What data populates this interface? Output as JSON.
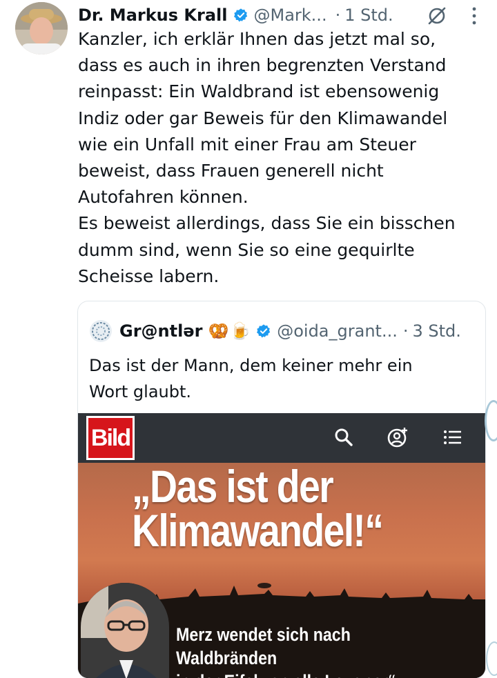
{
  "tweet": {
    "author_name": "Dr. Markus Krall",
    "handle": "@Mark...",
    "separator": "·",
    "time": "1 Std.",
    "text": "Kanzler, ich erklär Ihnen das jetzt mal so,\ndass es auch in ihren begrenzten Verstand\nreinpasst: Ein Waldbrand ist ebensowenig\nIndiz oder gar Beweis für den Klimawandel\nwie ein Unfall mit einer Frau am Steuer\nbeweist, dass Frauen generell nicht\nAutofahren können.\nEs beweist allerdings, dass Sie ein bisschen\ndumm sind, wenn Sie so eine gequirlte\nScheisse labern.",
    "icons": {
      "verified": "verified-badge-icon",
      "grok": "grok-icon",
      "more": "more-options-icon"
    }
  },
  "quote": {
    "author_name": "Gr@ntlər",
    "emoji": [
      "🥨",
      "🍺"
    ],
    "handle": "@oida_grant...",
    "separator": "·",
    "time": "3 Std.",
    "text": "Das ist der Mann, dem keiner mehr ein\nWort glaubt.",
    "media": {
      "logo_text": "Bild",
      "headline": "„Das ist der\nKlimawandel!“",
      "subheadline": "Merz wendet sich nach Waldbränden\nin der Eifel „an alle Leugner“",
      "icons": [
        "search-icon",
        "user-add-icon",
        "menu-list-icon"
      ]
    }
  },
  "colors": {
    "text": "#0f1419",
    "secondary": "#536471",
    "verified": "#1d9bf0",
    "bild_red": "#d6151b"
  }
}
